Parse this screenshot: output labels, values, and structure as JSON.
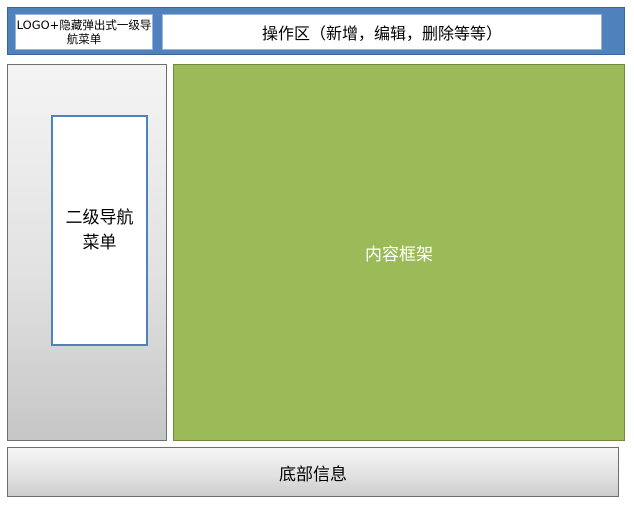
{
  "header": {
    "logo_text": "LOGO+隐藏弹出式一级导航菜单",
    "operations_text": "操作区（新增，编辑，删除等等）"
  },
  "sidebar": {
    "subnav_text": "二级导航菜单"
  },
  "content": {
    "label": "内容框架"
  },
  "footer": {
    "label": "底部信息"
  },
  "colors": {
    "header_bg": "#4f81bd",
    "content_bg": "#9bbb59",
    "sidebar_bg": "#e2e2e2",
    "footer_bg": "#e0e0e0",
    "box_white": "#ffffff"
  }
}
